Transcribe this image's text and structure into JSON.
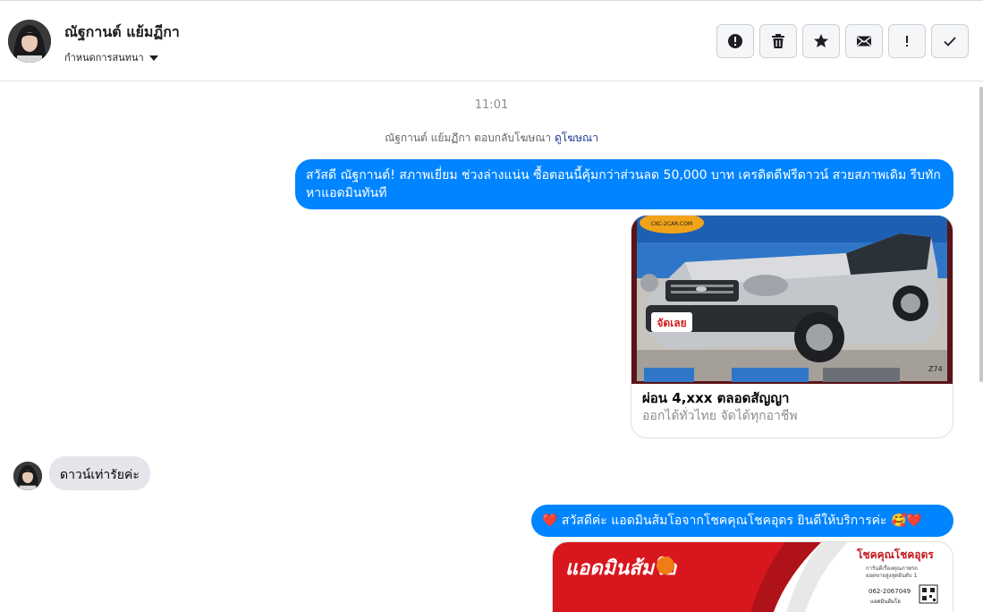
{
  "header": {
    "contact_name": "ณัฐกานต์ แย้มฏีกา",
    "assign_label": "กำหนดการสนทนา",
    "actions": [
      {
        "name": "report-button",
        "icon": "alert-circle-icon"
      },
      {
        "name": "delete-button",
        "icon": "trash-icon"
      },
      {
        "name": "star-button",
        "icon": "star-icon"
      },
      {
        "name": "mark-unread-button",
        "icon": "envelope-icon"
      },
      {
        "name": "important-button",
        "icon": "exclamation-icon"
      },
      {
        "name": "done-button",
        "icon": "check-icon"
      }
    ]
  },
  "thread": {
    "timestamp": "11:01",
    "ad_reply_text": "ณัฐกานต์ แย้มฏีกา ตอบกลับโฆษณา",
    "ad_reply_link": "ดูโฆษณา",
    "msg_out_1": "สวัสดี ณัฐกานต์!  สภาพเยี่ยม ช่วงล่างแน่น  ซื้อตอนนี้คุ้มกว่าส่วนลด 50,000 บาท เครดิตดีฟรีดาวน์  สวยสภาพเดิม รีบทักหาแอดมินทันที",
    "ad_card": {
      "title": "ผ่อน 4,xxx ตลอดสัญญา",
      "subtitle": "ออกได้ทั่วไทย จัดได้ทุกอาชีพ",
      "image_badge": "CKC-2CAR.COM",
      "image_tag": "จัดเลย",
      "image_code": "Z74"
    },
    "msg_in_1": "ดาวน์เท่ารัยค่ะ",
    "msg_out_2": "❤️ สวัสดีค่ะ แอดมินส้มโอจากโชคคุณโชคอุดร ยินดีให้บริการค่ะ  🥰❤️",
    "promo_card": {
      "headline": "แอดมินส้มโอ",
      "shop_name": "โชคคุณโชคอุดร",
      "shop_line1": "การันตีเรื่องคุณภาพรถ",
      "shop_line2": "ยอดขายสูงสุดอันดับ 1",
      "phone": "062-2067049",
      "handle": "แอดมินส้มโอ"
    }
  },
  "colors": {
    "outgoing_bubble": "#0084ff",
    "incoming_bubble": "#e4e6eb",
    "link": "#1f3a93"
  }
}
